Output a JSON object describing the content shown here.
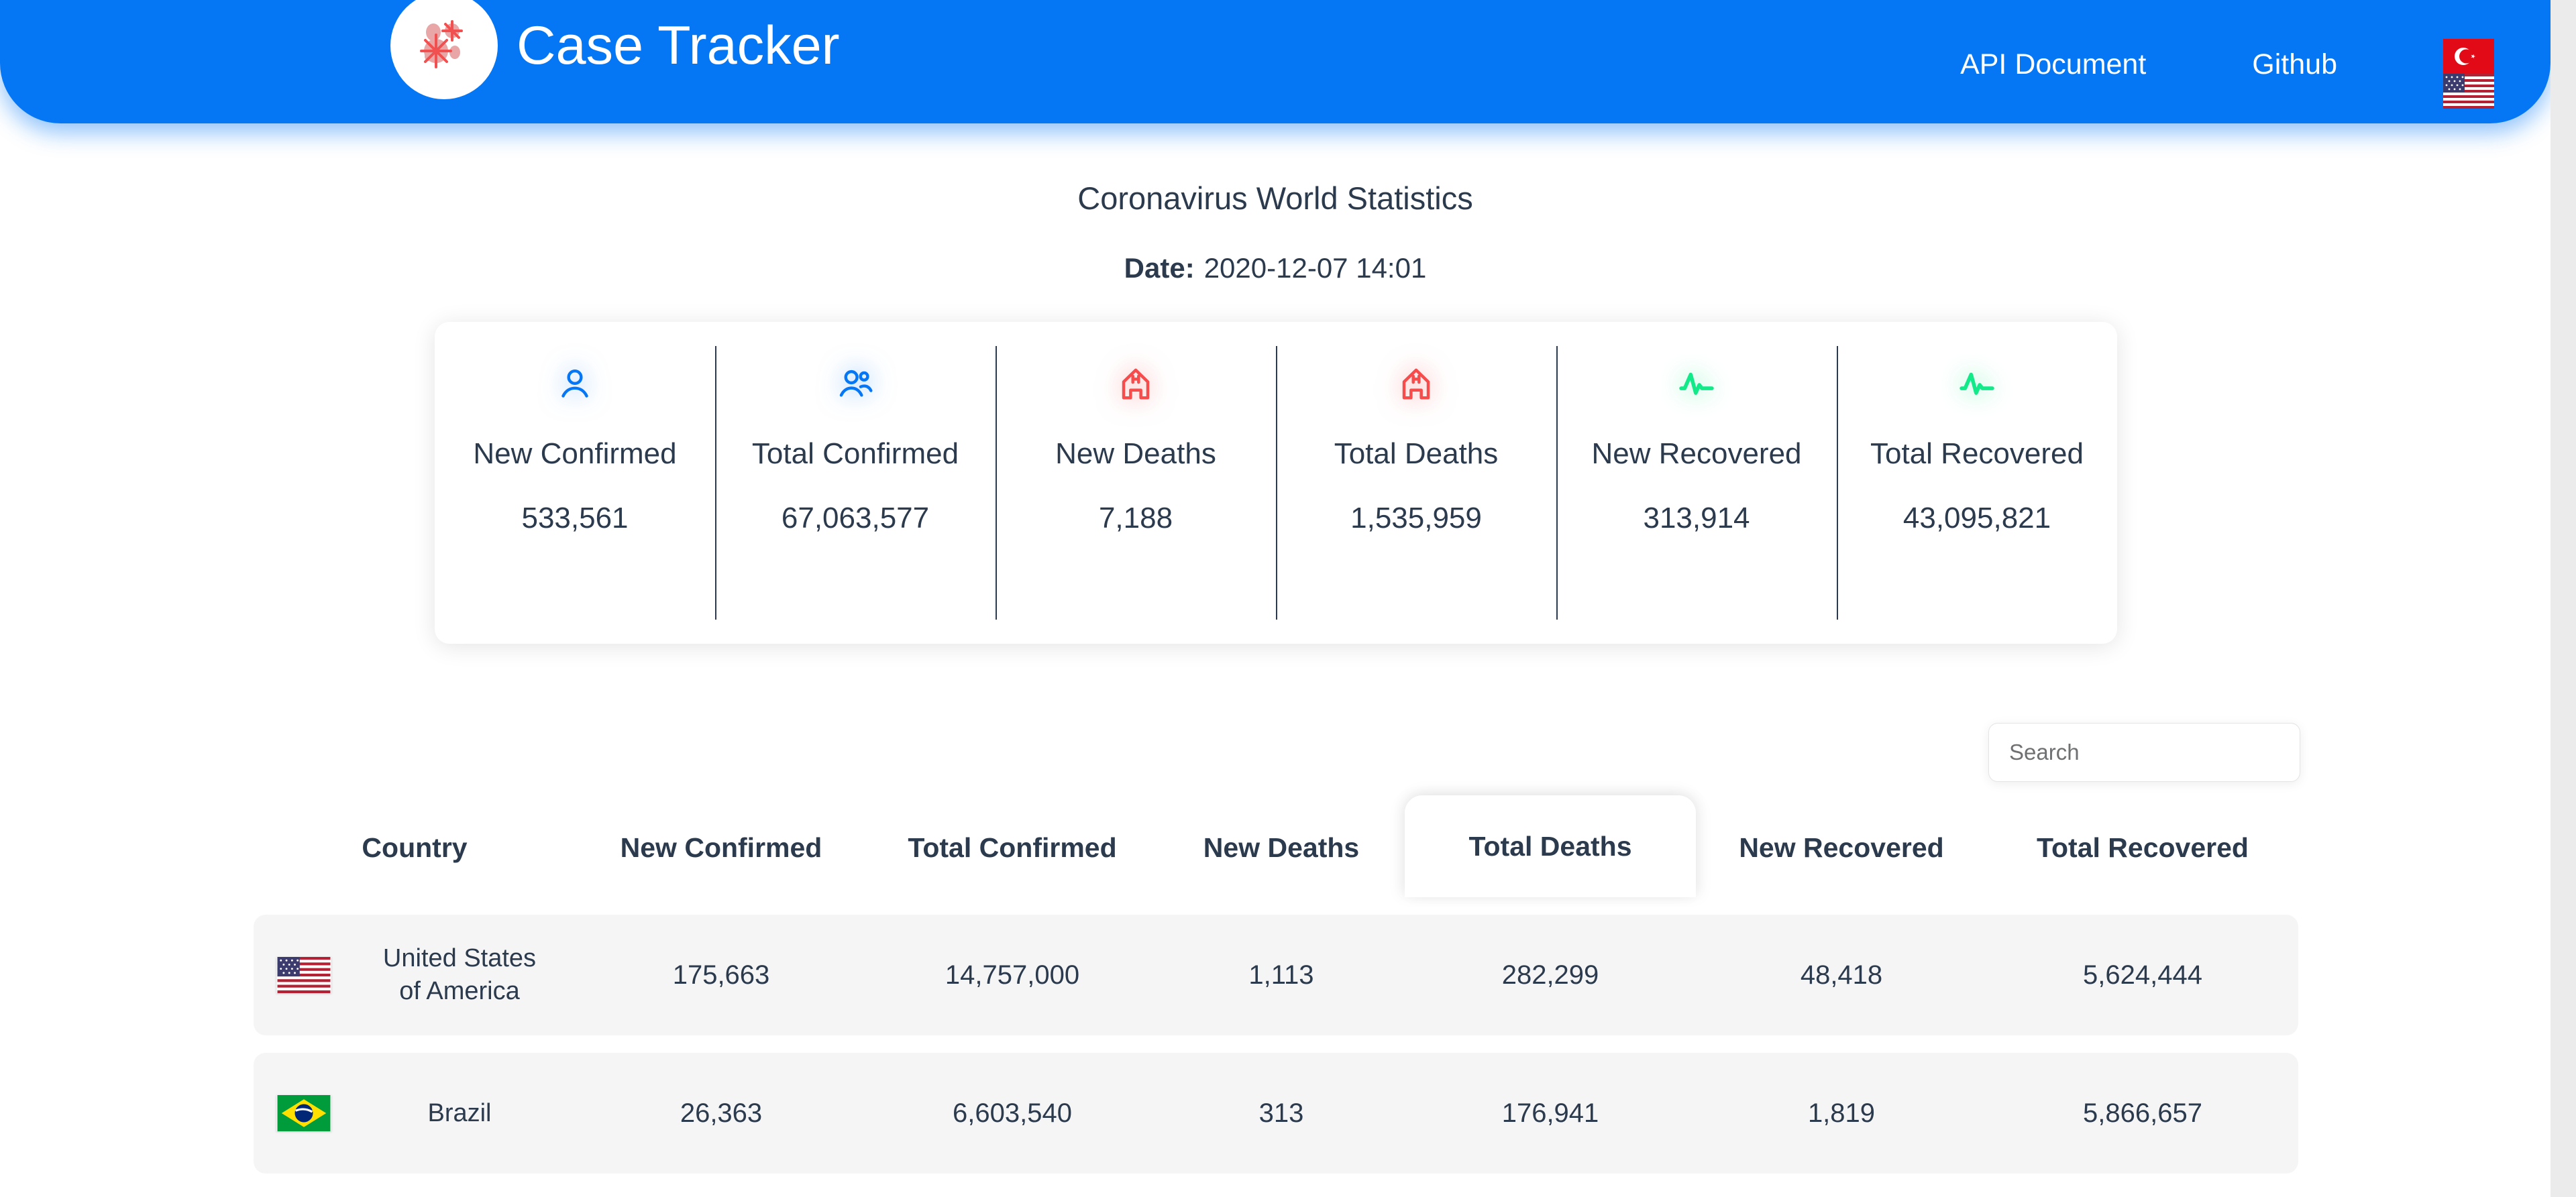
{
  "header": {
    "brand_title": "Case Tracker",
    "logo_icon": "coronavirus-icon",
    "nav": [
      {
        "label": "API Document",
        "icon": ""
      },
      {
        "label": "Github",
        "icon": ""
      }
    ],
    "language_switcher": {
      "icon": "flag-selector",
      "flags": [
        "turkey-flag",
        "usa-flag"
      ]
    },
    "background_color": "#0577f5"
  },
  "page": {
    "title": "Coronavirus World Statistics",
    "date_label": "Date:",
    "date_value": "2020-12-07 14:01"
  },
  "summary": {
    "stats": [
      {
        "icon": "person-icon",
        "icon_color": "#0577f5",
        "label": "New Confirmed",
        "value": "533,561"
      },
      {
        "icon": "people-group-icon",
        "icon_color": "#0577f5",
        "label": "Total Confirmed",
        "value": "67,063,577"
      },
      {
        "icon": "hospital-icon",
        "icon_color": "#f64c4c",
        "label": "New Deaths",
        "value": "7,188"
      },
      {
        "icon": "hospital-icon",
        "icon_color": "#f64c4c",
        "label": "Total Deaths",
        "value": "1,535,959"
      },
      {
        "icon": "pulse-icon",
        "icon_color": "#12e988",
        "label": "New Recovered",
        "value": "313,914"
      },
      {
        "icon": "pulse-icon",
        "icon_color": "#12e988",
        "label": "Total Recovered",
        "value": "43,095,821"
      }
    ]
  },
  "search": {
    "placeholder": "Search",
    "value": ""
  },
  "table": {
    "active_column": "Total Deaths",
    "columns": [
      "Country",
      "New Confirmed",
      "Total Confirmed",
      "New Deaths",
      "Total Deaths",
      "New Recovered",
      "Total Recovered"
    ],
    "rows": [
      {
        "flag": "usa-flag",
        "country": "United States of America",
        "new_confirmed": "175,663",
        "total_confirmed": "14,757,000",
        "new_deaths": "1,113",
        "total_deaths": "282,299",
        "new_recovered": "48,418",
        "total_recovered": "5,624,444"
      },
      {
        "flag": "brazil-flag",
        "country": "Brazil",
        "new_confirmed": "26,363",
        "total_confirmed": "6,603,540",
        "new_deaths": "313",
        "total_deaths": "176,941",
        "new_recovered": "1,819",
        "total_recovered": "5,866,657"
      }
    ]
  }
}
